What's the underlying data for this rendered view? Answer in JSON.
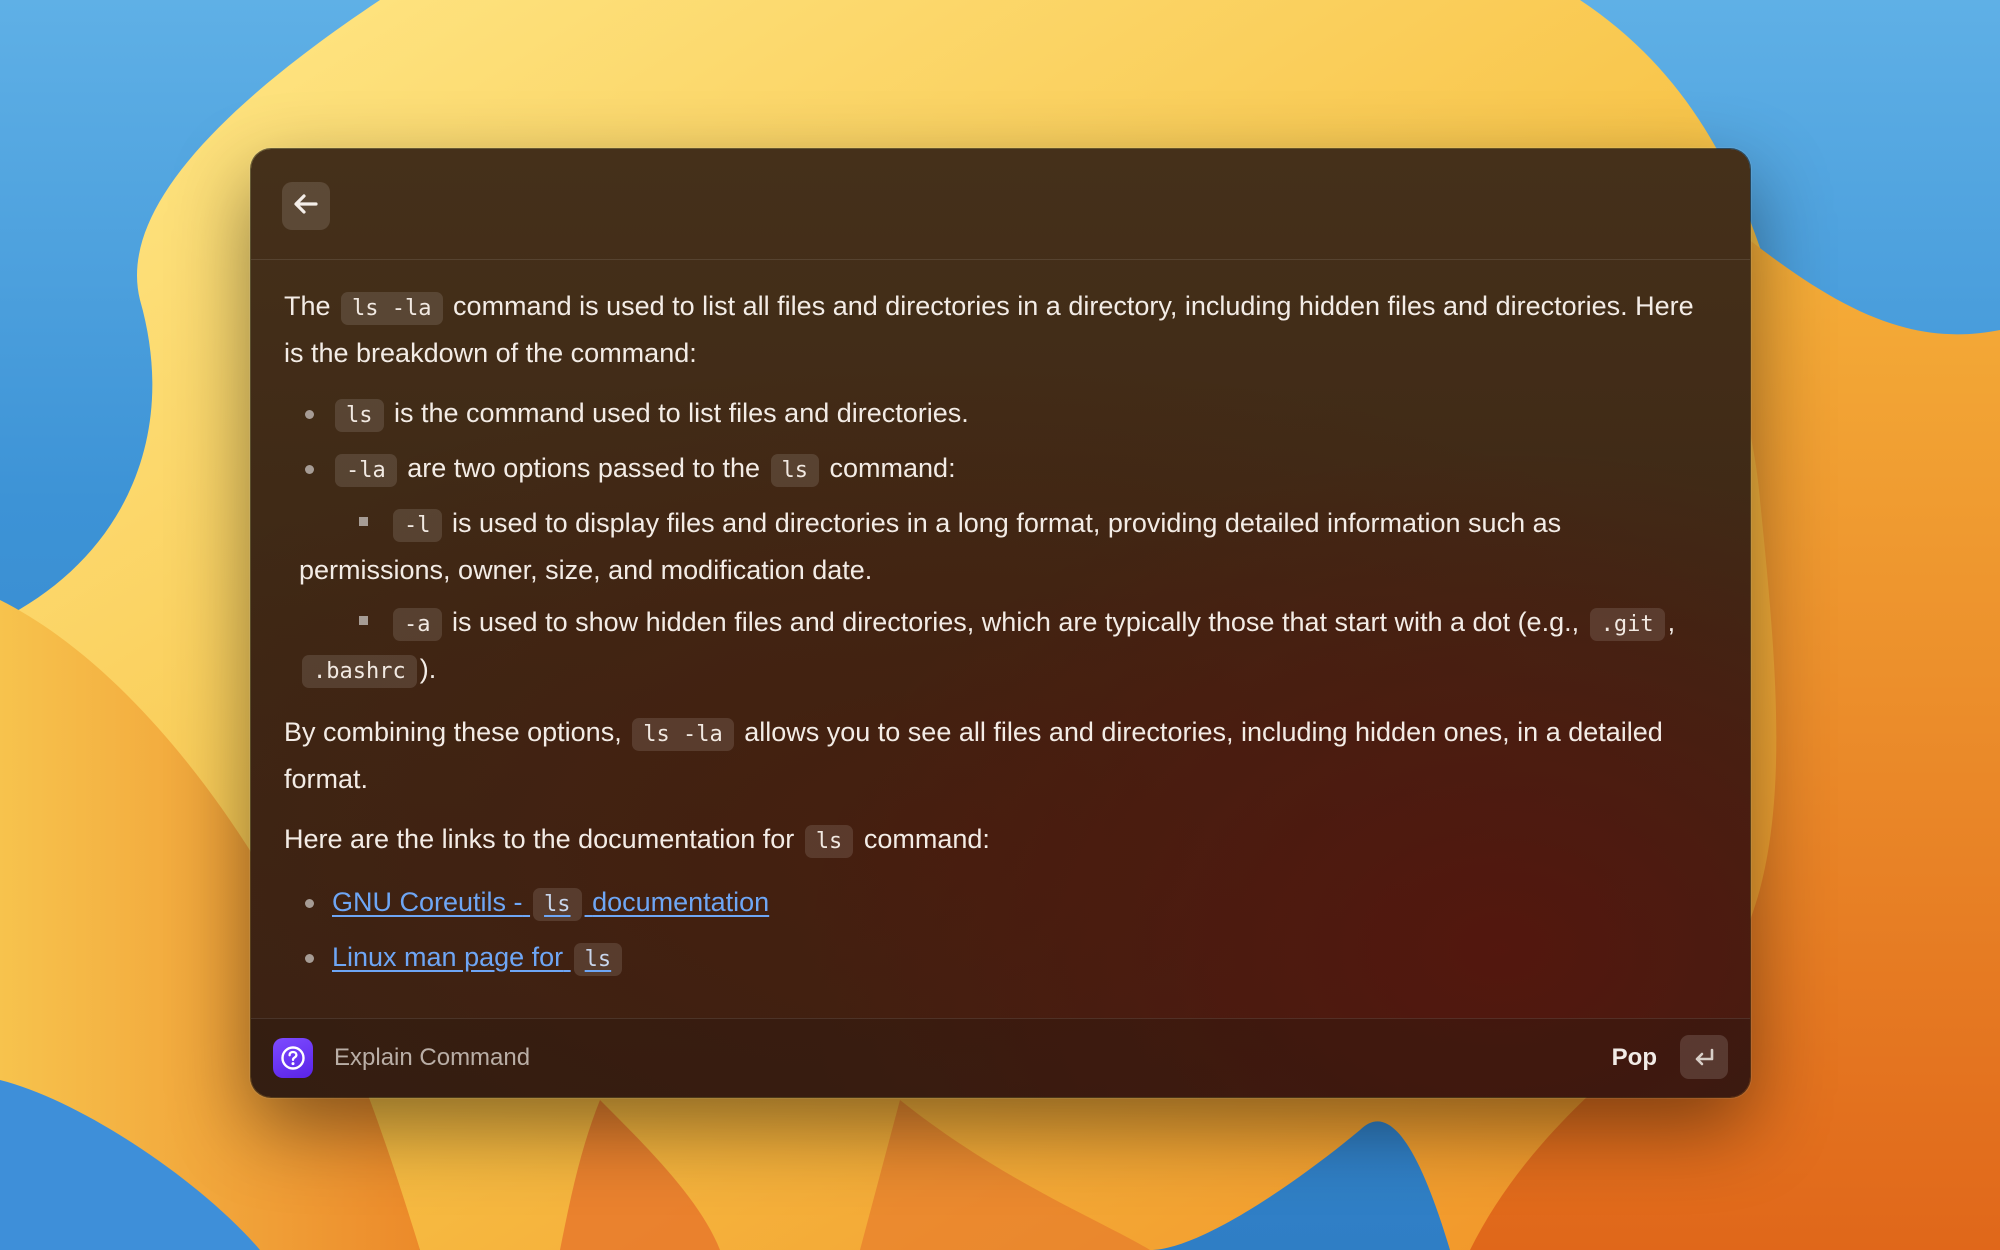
{
  "window": {
    "back_icon": "arrow-left-icon"
  },
  "content": {
    "intro": {
      "text1": "The",
      "code1": "ls -la",
      "text2": "command is used to list all files and directories in a directory, including hidden files and directories. Here is the breakdown of the command:"
    },
    "breakdown": [
      {
        "code": "ls",
        "text": "is the command used to list files and directories."
      },
      {
        "code": "-la",
        "text1": "are two options passed to the",
        "code2": "ls",
        "text2": "command:"
      }
    ],
    "options": [
      {
        "code": "-l",
        "text": "is used to display files and directories in a long format, providing detailed information such as permissions, owner, size, and modification date."
      },
      {
        "code": "-a",
        "text1": "is used to show hidden files and directories, which are typically those that start with a dot (e.g.,",
        "code2": ".git",
        "sep": ",",
        "code3": ".bashrc",
        "text2": ")."
      }
    ],
    "summary": {
      "text1": "By combining these options,",
      "code": "ls -la",
      "text2": "allows you to see all files and directories, including hidden ones, in a detailed format."
    },
    "links_intro": {
      "text1": "Here are the links to the documentation for",
      "code": "ls",
      "text2": "command:"
    },
    "links": [
      {
        "text1": "GNU Coreutils -",
        "code": "ls",
        "text2": "documentation"
      },
      {
        "text1": "Linux man page for",
        "code": "ls",
        "text2": ""
      }
    ]
  },
  "footer": {
    "extension_icon": "question-circle-icon",
    "title": "Explain Command",
    "action_label": "Pop",
    "shortcut_icon": "return-key-icon"
  },
  "colors": {
    "link": "#6ea6f5",
    "accent": "#6a35f5"
  }
}
